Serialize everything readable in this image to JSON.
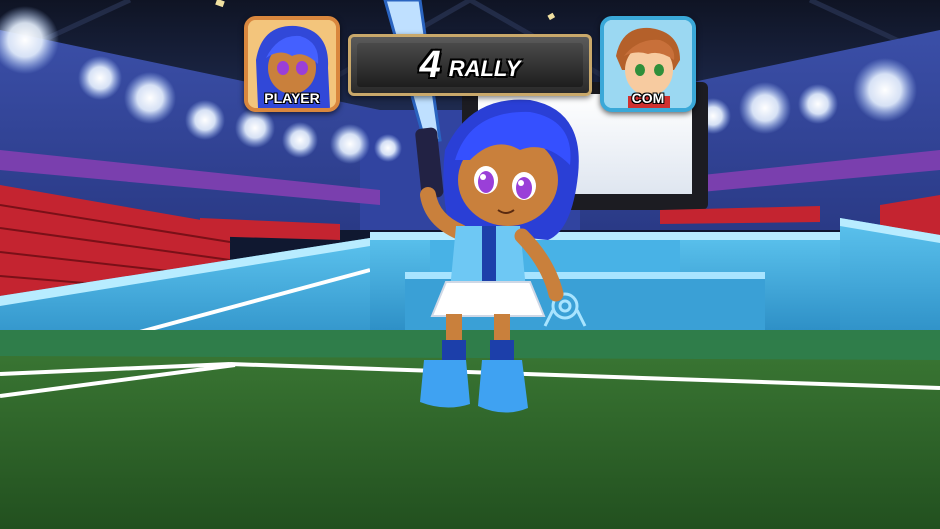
{
  "hud": {
    "player_label": "PLAYER",
    "com_label": "COM",
    "rally_count": "4",
    "rally_label": "RALLY"
  },
  "colors": {
    "player_frame": "#d9873e",
    "com_frame": "#3aa8d8",
    "court_green": "#2f6a2a",
    "wall_blue": "#3fa8de"
  }
}
